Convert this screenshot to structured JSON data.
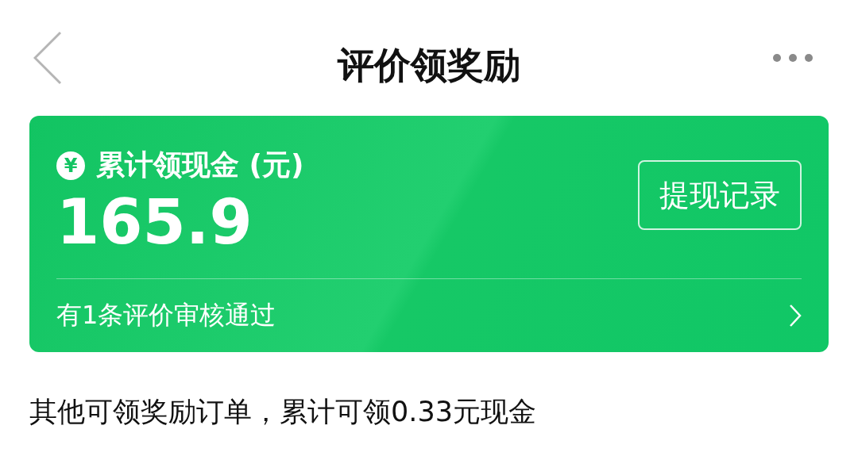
{
  "header": {
    "title": "评价领奖励"
  },
  "summary_card": {
    "currency_symbol": "¥",
    "label": "累计领现金 (元)",
    "amount": "165.9",
    "button": "提现记录",
    "notice": "有1条评价审核通过"
  },
  "footer_text": "其他可领奖励订单，累计可领0.33元现金"
}
